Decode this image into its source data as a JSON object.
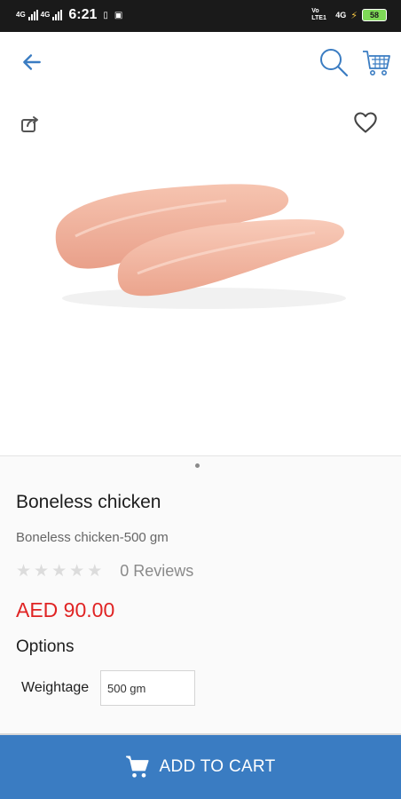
{
  "status_bar": {
    "sig1": "4G",
    "sig2": "4G",
    "time": "6:21",
    "right_tag1": "Vo LTE1",
    "right_tag2": "4G",
    "battery": "58"
  },
  "top_bar": {
    "back_icon": "arrow-left-icon",
    "search_icon": "search-icon",
    "cart_icon": "cart-icon",
    "accent_color": "#3a7cc2"
  },
  "product": {
    "name": "Boneless chicken",
    "description": "Boneless chicken-500 gm",
    "rating": 0,
    "stars": [
      "★",
      "★",
      "★",
      "★",
      "★"
    ],
    "reviews_label": "0 Reviews",
    "price": "AED 90.00",
    "price_color": "#e02424"
  },
  "options": {
    "title": "Options",
    "weight_label": "Weightage",
    "weight_value": "500 gm"
  },
  "add_to_cart": {
    "label": "ADD TO CART",
    "bg_color": "#3a7cc2"
  }
}
